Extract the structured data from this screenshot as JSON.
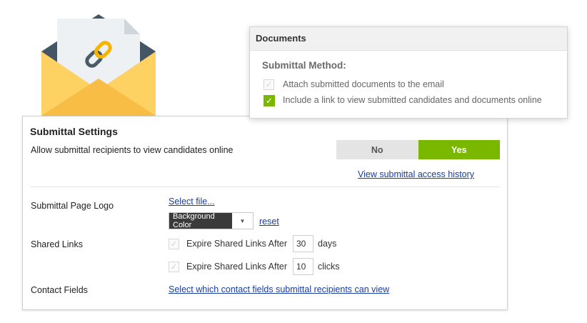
{
  "documents_popup": {
    "title": "Documents",
    "section_label": "Submittal Method:",
    "options": [
      {
        "label": "Attach submitted documents to the email",
        "checked": false
      },
      {
        "label": "Include a link to view submitted candidates and documents online",
        "checked": true
      }
    ]
  },
  "settings": {
    "title": "Submittal Settings",
    "allow_online": {
      "label": "Allow submittal recipients to view candidates online",
      "no_label": "No",
      "yes_label": "Yes",
      "selected": "Yes"
    },
    "access_history_link": "View submittal access history",
    "page_logo": {
      "label": "Submittal Page Logo",
      "select_file_link": "Select file...",
      "background_select_value": "Background Color",
      "reset_link": "reset"
    },
    "shared_links": {
      "label": "Shared Links",
      "rules": [
        {
          "text": "Expire Shared Links After",
          "value": "30",
          "unit": "days",
          "checked": false
        },
        {
          "text": "Expire Shared Links After",
          "value": "10",
          "unit": "clicks",
          "checked": false
        }
      ]
    },
    "contact_fields": {
      "label": "Contact Fields",
      "link": "Select which contact fields submittal recipients can view"
    }
  },
  "colors": {
    "accent_green": "#7ab800",
    "link_blue": "#1a3d9e",
    "envelope_yellow": "#fdd162",
    "envelope_dark": "#445566"
  },
  "icons": [
    "envelope-icon",
    "chain-link-icon",
    "check-icon",
    "chevron-down-icon"
  ]
}
